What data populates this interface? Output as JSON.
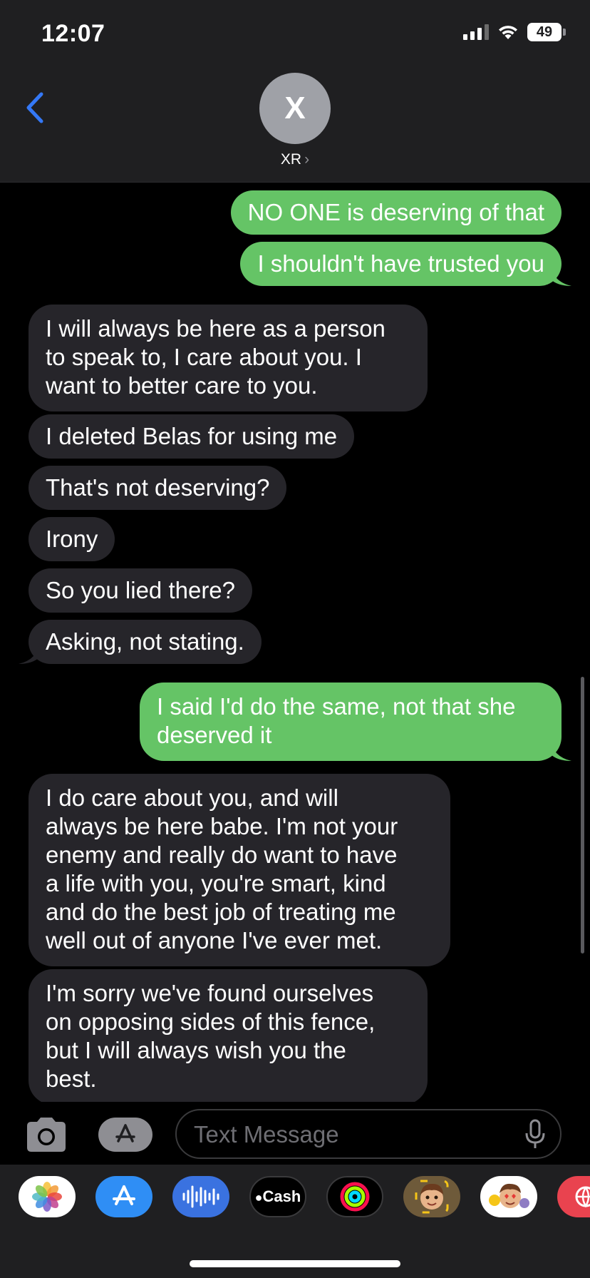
{
  "status_bar": {
    "time": "12:07",
    "battery": "49"
  },
  "header": {
    "avatar_initial": "X",
    "contact_name": "XR",
    "chevron": "›"
  },
  "messages": [
    {
      "from": "me",
      "text": "NO ONE is deserving of that"
    },
    {
      "from": "me",
      "text": "I shouldn't have trusted you"
    },
    {
      "from": "them",
      "text": "I will always be here as a person\nto speak to, I care about you. I\nwant to better care to you."
    },
    {
      "from": "them",
      "text": "I deleted Belas for using me"
    },
    {
      "from": "them",
      "text": "That's not deserving?"
    },
    {
      "from": "them",
      "text": "Irony"
    },
    {
      "from": "them",
      "text": "So you lied there?"
    },
    {
      "from": "them",
      "text": "Asking, not stating."
    },
    {
      "from": "me",
      "text": "I said I'd do the same, not that she\ndeserved it"
    },
    {
      "from": "them",
      "text": "I do care about you, and will\nalways be here babe. I'm not your\nenemy and really do want to have\na life with you, you're smart, kind\nand do the best job of treating me\nwell out of anyone I've ever met."
    },
    {
      "from": "them",
      "text": "I'm sorry we've found ourselves\non opposing sides of this fence,\nbut I will always wish you the\nbest."
    }
  ],
  "input": {
    "placeholder": "Text Message"
  },
  "app_drawer": [
    {
      "name": "photos-app-icon"
    },
    {
      "name": "app-store-icon"
    },
    {
      "name": "audio-message-icon"
    },
    {
      "name": "apple-cash-icon",
      "label": "Cash"
    },
    {
      "name": "fitness-icon"
    },
    {
      "name": "memoji-icon"
    },
    {
      "name": "memoji-stickers-icon"
    },
    {
      "name": "web-search-icon"
    }
  ],
  "colors": {
    "sent_bubble": "#65c466",
    "received_bubble": "#26252a",
    "accent": "#3478f6"
  }
}
